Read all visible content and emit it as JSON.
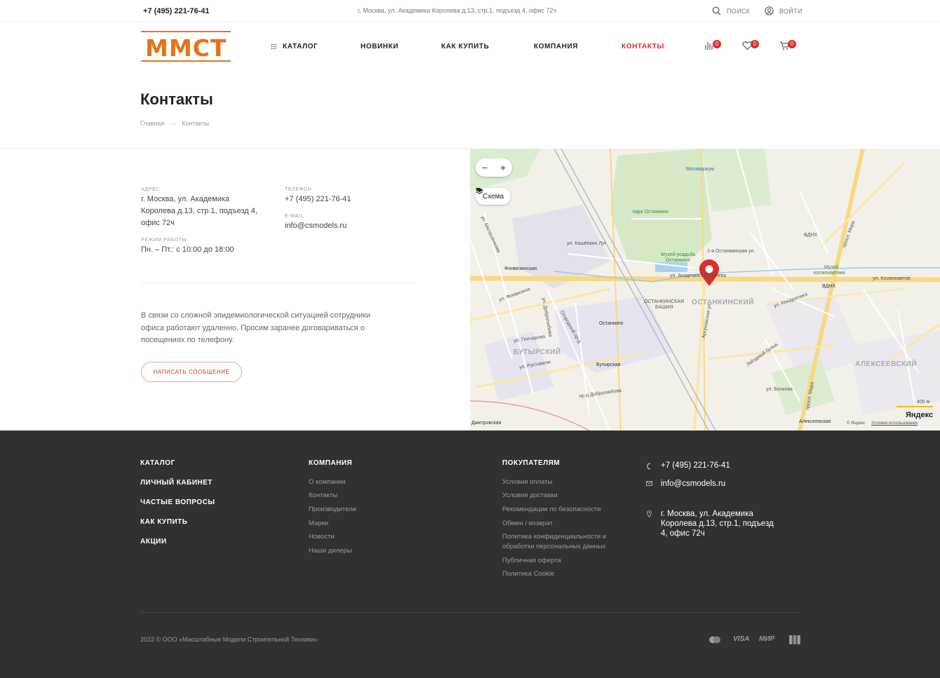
{
  "topbar": {
    "phone": "+7 (495) 221-76-41",
    "address": "г. Москва, ул. Академика Королева д.13, стр.1, подъезд 4, офис 72ч",
    "search_label": "поиск",
    "login_label": "войти"
  },
  "header": {
    "logo_text": "ММСТ",
    "nav": [
      {
        "label": "Каталог"
      },
      {
        "label": "Новинки"
      },
      {
        "label": "Как купить"
      },
      {
        "label": "Компания"
      },
      {
        "label": "Контакты",
        "active": true
      }
    ],
    "compare_count": "0",
    "favorites_count": "0",
    "cart_count": "0"
  },
  "page": {
    "title": "Контакты",
    "breadcrumbs": [
      "Главная",
      "—",
      "Контакты"
    ]
  },
  "contacts": {
    "address_label": "Адрес",
    "address_lines": [
      "г. Москва, ул. Академика",
      "Королева д.13, стр.1, подъезд 4,",
      "офис 72ч"
    ],
    "phone_label": "Телефон",
    "phone": "+7 (495) 221-76-41",
    "email_label": "E-mail",
    "email": "info@csmodels.ru",
    "hours_label": "Режим работы",
    "hours": "Пн. – Пт.: с 10:00 до 18:00",
    "notice_lines": [
      "В связи со сложной эпидемиологической ситуацией сотрудники",
      "офиса работают удаленно. Просим заранее договариваться о",
      "посещениях по телефону."
    ],
    "message_button": "Написать сообщение"
  },
  "map": {
    "zoom_out": "−",
    "zoom_in": "+",
    "layer_label": "Схема",
    "labels": {
      "moskvarium": "Москвариум",
      "park": "парк Останкино",
      "museum": "Музей-усадьба",
      "museum2": "Останкино",
      "fonvizinskaya": "Фонвизинская",
      "ostankino_st": "Останкино",
      "butyrskaya": "Бутырская",
      "vdnh": "ВДНХ",
      "vdnh2": "ВДНХ",
      "cosmos_museum": "Музей",
      "cosmos_museum2": "космонавтики",
      "tower": "ОСТАНКИНСКАЯ",
      "tower2": "БАШНЯ",
      "ostankinsky": "ОСТАНКИНСКИЙ",
      "butyrsky": "БУТЫРСКИЙ",
      "alekseevsky": "АЛЕКСЕЕВСКИЙ",
      "korolyova": "ул. Академика Королёва",
      "kosmonavtov": "ул. Космонавтов",
      "argunovskaya": "Аргуновская ул.",
      "mira": "просп. Мира",
      "mira2": "просп. Мира",
      "rustaveli": "ул. Руставели",
      "goncharova": "ул. Гончарова",
      "fonvizina": "ул. Фонвизина",
      "milashenkova": "ул. Милашенкова",
      "kashenkin": "ул. Кашёнкин Луг",
      "ostankinskaya": "1-я Останкинская ул.",
      "kondratyuka": "ул. Кондратюка",
      "zvezdny": "Звёздный бульв.",
      "dobrolyubova": "ул. Добролюбова",
      "dobrolyubova_pr": "пр-д Добролюбова",
      "ogorodny": "Огородный пр-д",
      "bochkova": "ул. Бочкова",
      "alekseevskaya": "Алексеевская",
      "dmitrovskaya": "Дмитровская",
      "scale": "400 м",
      "brand": "Яндекс",
      "copyright": "© Яндекс",
      "terms": "Условия использования"
    }
  },
  "footer": {
    "main_links": [
      "Каталог",
      "Личный кабинет",
      "Частые вопросы",
      "Как купить",
      "Акции"
    ],
    "company_head": "Компания",
    "company_links": [
      "О компании",
      "Контакты",
      "Производители",
      "Марки",
      "Новости",
      "Наши дилеры"
    ],
    "buyers_head": "Покупателям",
    "buyers_links": [
      "Условия оплаты",
      "Условия доставки",
      "Рекомендации по безопасности",
      "Обмен / возврат",
      "Политика конфиденциальности и",
      "обработки персональных данных",
      "Публичная оферта",
      "Политика Cookie"
    ],
    "phone": "+7 (495) 221-76-41",
    "email": "info@csmodels.ru",
    "address_lines": [
      "г. Москва, ул. Академика",
      "Королева д.13, стр.1, подъезд",
      "4, офис 72ч"
    ],
    "copyright": "2022 © ООО «Масштабные Модели Строительной Техники»",
    "payments": [
      "VISA",
      "МИР"
    ]
  },
  "colors": {
    "accent": "#d9302a",
    "logo": "#e3731b",
    "footer_bg": "#313131"
  }
}
